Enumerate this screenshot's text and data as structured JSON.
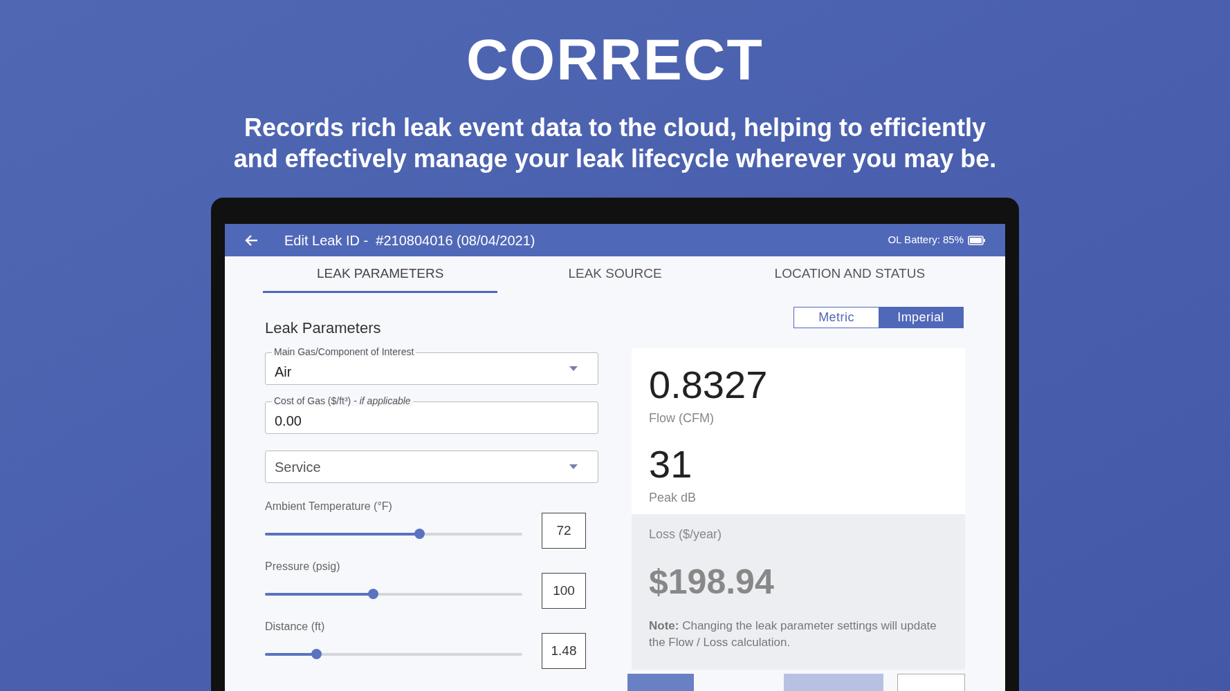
{
  "headline": "CORRECT",
  "subtitle": "Records rich leak event data to the cloud, helping to efficiently and effectively manage your leak lifecycle wherever you may be.",
  "app_bar": {
    "title": "Edit Leak ID -  #210804016 (08/04/2021)",
    "battery": "OL Battery: 85%"
  },
  "tabs": [
    {
      "label": "LEAK PARAMETERS",
      "selected": true
    },
    {
      "label": "LEAK SOURCE",
      "selected": false
    },
    {
      "label": "LOCATION AND STATUS",
      "selected": false
    }
  ],
  "section_title": "Leak Parameters",
  "fields": [
    {
      "kind": "select",
      "label": "Main Gas/Component of Interest",
      "value": "Air"
    },
    {
      "kind": "text",
      "label": "Cost of Gas ($/ft³) - *if applicable*",
      "value": "0.00"
    },
    {
      "kind": "select",
      "placeholder": "Service"
    }
  ],
  "sliders": [
    {
      "label": "Ambient Temperature (°F)",
      "level": 0.6,
      "value": "72"
    },
    {
      "label": "Pressure (psig)",
      "level": 0.42,
      "value": "100"
    },
    {
      "label": "Distance (ft)",
      "level": 0.2,
      "value": "1.48"
    }
  ],
  "units": [
    {
      "label": "Metric",
      "selected": false
    },
    {
      "label": "Imperial",
      "selected": true
    }
  ],
  "results": [
    {
      "value": "0.8327",
      "label": "Flow (CFM)"
    },
    {
      "value": "31",
      "label": "Peak dB"
    }
  ],
  "loss": {
    "label": "Loss ($/year)",
    "value": "$198.94",
    "note": "**Note:** Changing the leak parameter settings will update the Flow / Loss calculation."
  },
  "buttons": [
    {
      "kind": "primary"
    },
    {
      "kind": "disabled"
    },
    {
      "kind": "outline"
    }
  ]
}
